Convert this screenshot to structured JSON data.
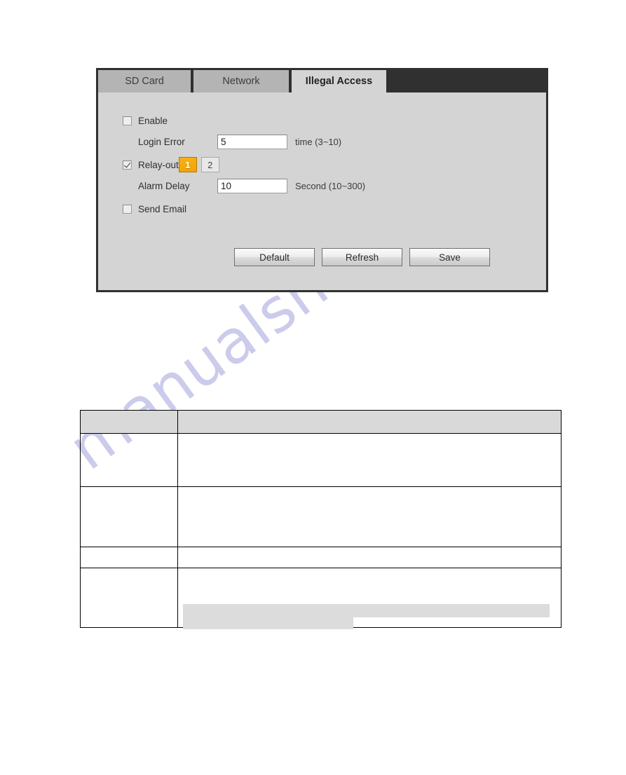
{
  "watermark": {
    "text": "manualshive.com"
  },
  "panel": {
    "tabs": [
      {
        "label": "SD Card",
        "active": false
      },
      {
        "label": "Network",
        "active": false
      },
      {
        "label": "Illegal Access",
        "active": true
      }
    ],
    "fields": {
      "enable": {
        "label": "Enable",
        "checked": false
      },
      "login_error": {
        "label": "Login Error",
        "value": "5",
        "unit": "time (3~10)"
      },
      "relay_out": {
        "label": "Relay-out",
        "checked": true,
        "options": [
          "1",
          "2"
        ],
        "selected": "1"
      },
      "alarm_delay": {
        "label": "Alarm Delay",
        "value": "10",
        "unit": "Second (10~300)"
      },
      "send_email": {
        "label": "Send Email",
        "checked": false
      }
    },
    "buttons": {
      "default": "Default",
      "refresh": "Refresh",
      "save": "Save"
    }
  },
  "description_table": {
    "headers": [
      "",
      ""
    ],
    "rows": [
      {
        "parameter": "",
        "description": ""
      },
      {
        "parameter": "",
        "description": ""
      },
      {
        "parameter": "",
        "description": ""
      },
      {
        "parameter": "",
        "description": ""
      }
    ]
  },
  "colors": {
    "accent_orange": "#f2a307",
    "panel_background": "#d4d4d4",
    "tab_bar_dark": "#303030",
    "tab_inactive": "#b4b4b4",
    "table_header": "#d9d9d9",
    "watermark": "#c9c9ec"
  }
}
